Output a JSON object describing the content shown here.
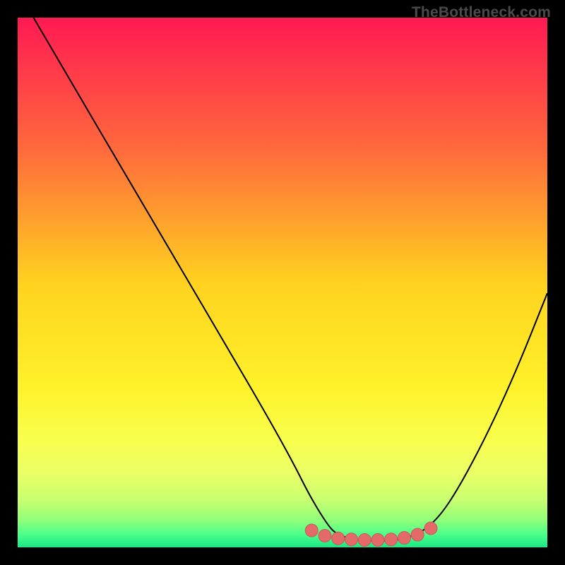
{
  "watermark": "TheBottleneck.com",
  "colors": {
    "background": "#000000",
    "curve_stroke": "#000000",
    "marker_fill": "#e46a6a",
    "marker_stroke": "#c85a5a",
    "gradient_stops": [
      {
        "offset": 0.0,
        "color": "#ff1a52"
      },
      {
        "offset": 0.25,
        "color": "#ff6a3c"
      },
      {
        "offset": 0.5,
        "color": "#ffd21f"
      },
      {
        "offset": 0.7,
        "color": "#fff22a"
      },
      {
        "offset": 0.8,
        "color": "#f8ff4e"
      },
      {
        "offset": 0.86,
        "color": "#eaff66"
      },
      {
        "offset": 0.91,
        "color": "#c9ff70"
      },
      {
        "offset": 0.95,
        "color": "#8eff7a"
      },
      {
        "offset": 0.975,
        "color": "#4dff8a"
      },
      {
        "offset": 1.0,
        "color": "#17e885"
      }
    ]
  },
  "chart_data": {
    "type": "line",
    "title": "",
    "xlabel": "",
    "ylabel": "",
    "xlim": [
      0,
      100
    ],
    "ylim": [
      0,
      100
    ],
    "grid": false,
    "series": [
      {
        "name": "bottleneck-curve",
        "x": [
          3,
          10,
          20,
          30,
          40,
          47,
          52,
          55,
          58,
          60,
          63,
          66,
          70,
          74,
          78,
          82,
          88,
          94,
          100
        ],
        "y": [
          100,
          88,
          71,
          54,
          37,
          25,
          16,
          10,
          5,
          2.5,
          1.6,
          1.2,
          1.2,
          1.8,
          4,
          9,
          20,
          33,
          48
        ]
      }
    ],
    "markers": {
      "name": "highlight-points",
      "x": [
        55.5,
        58,
        60.5,
        63,
        65.5,
        68,
        70.5,
        73,
        75.5,
        78
      ],
      "y": [
        3.2,
        2.2,
        1.7,
        1.5,
        1.4,
        1.4,
        1.5,
        1.8,
        2.4,
        3.6
      ]
    }
  }
}
